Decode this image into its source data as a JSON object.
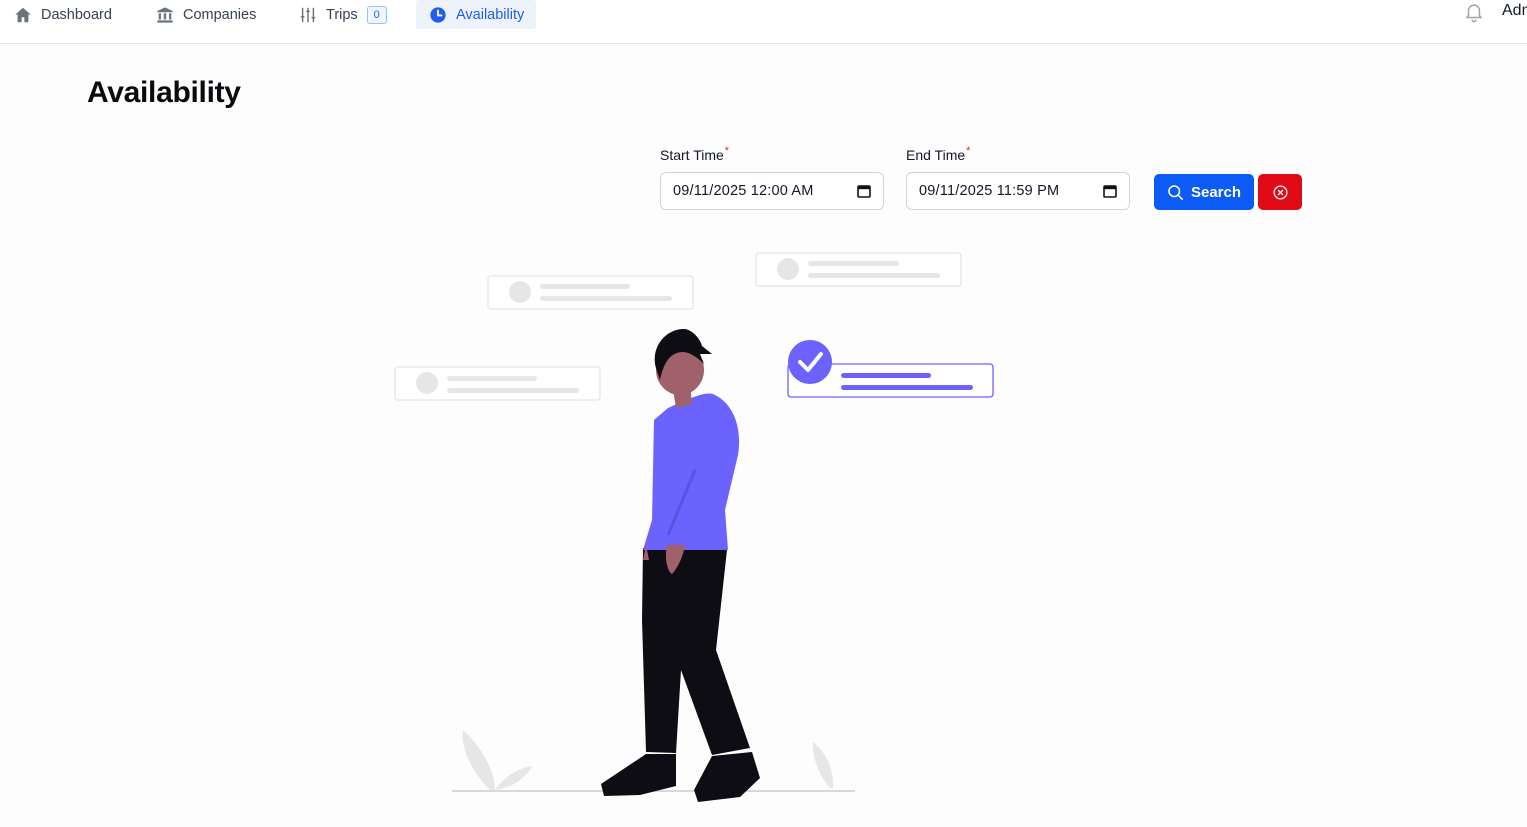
{
  "nav": {
    "items": [
      {
        "label": "Dashboard",
        "icon": "home-icon"
      },
      {
        "label": "Companies",
        "icon": "bank-icon"
      },
      {
        "label": "Trips",
        "icon": "sliders-icon",
        "badge": "0"
      },
      {
        "label": "Availability",
        "icon": "clock-icon"
      }
    ],
    "active": "Availability",
    "user_name": "Admin"
  },
  "page": {
    "title": "Availability"
  },
  "filters": {
    "start_label": "Start Time",
    "start_value": "09/11/2025 12:00 AM",
    "end_label": "End Time",
    "end_value": "09/11/2025 11:59 PM",
    "required_mark": "*",
    "search_label": "Search"
  },
  "colors": {
    "primary": "#0d5bf5",
    "danger": "#e10a17",
    "accent": "#6c63ff",
    "active_tab_bg": "#eef2fb"
  }
}
